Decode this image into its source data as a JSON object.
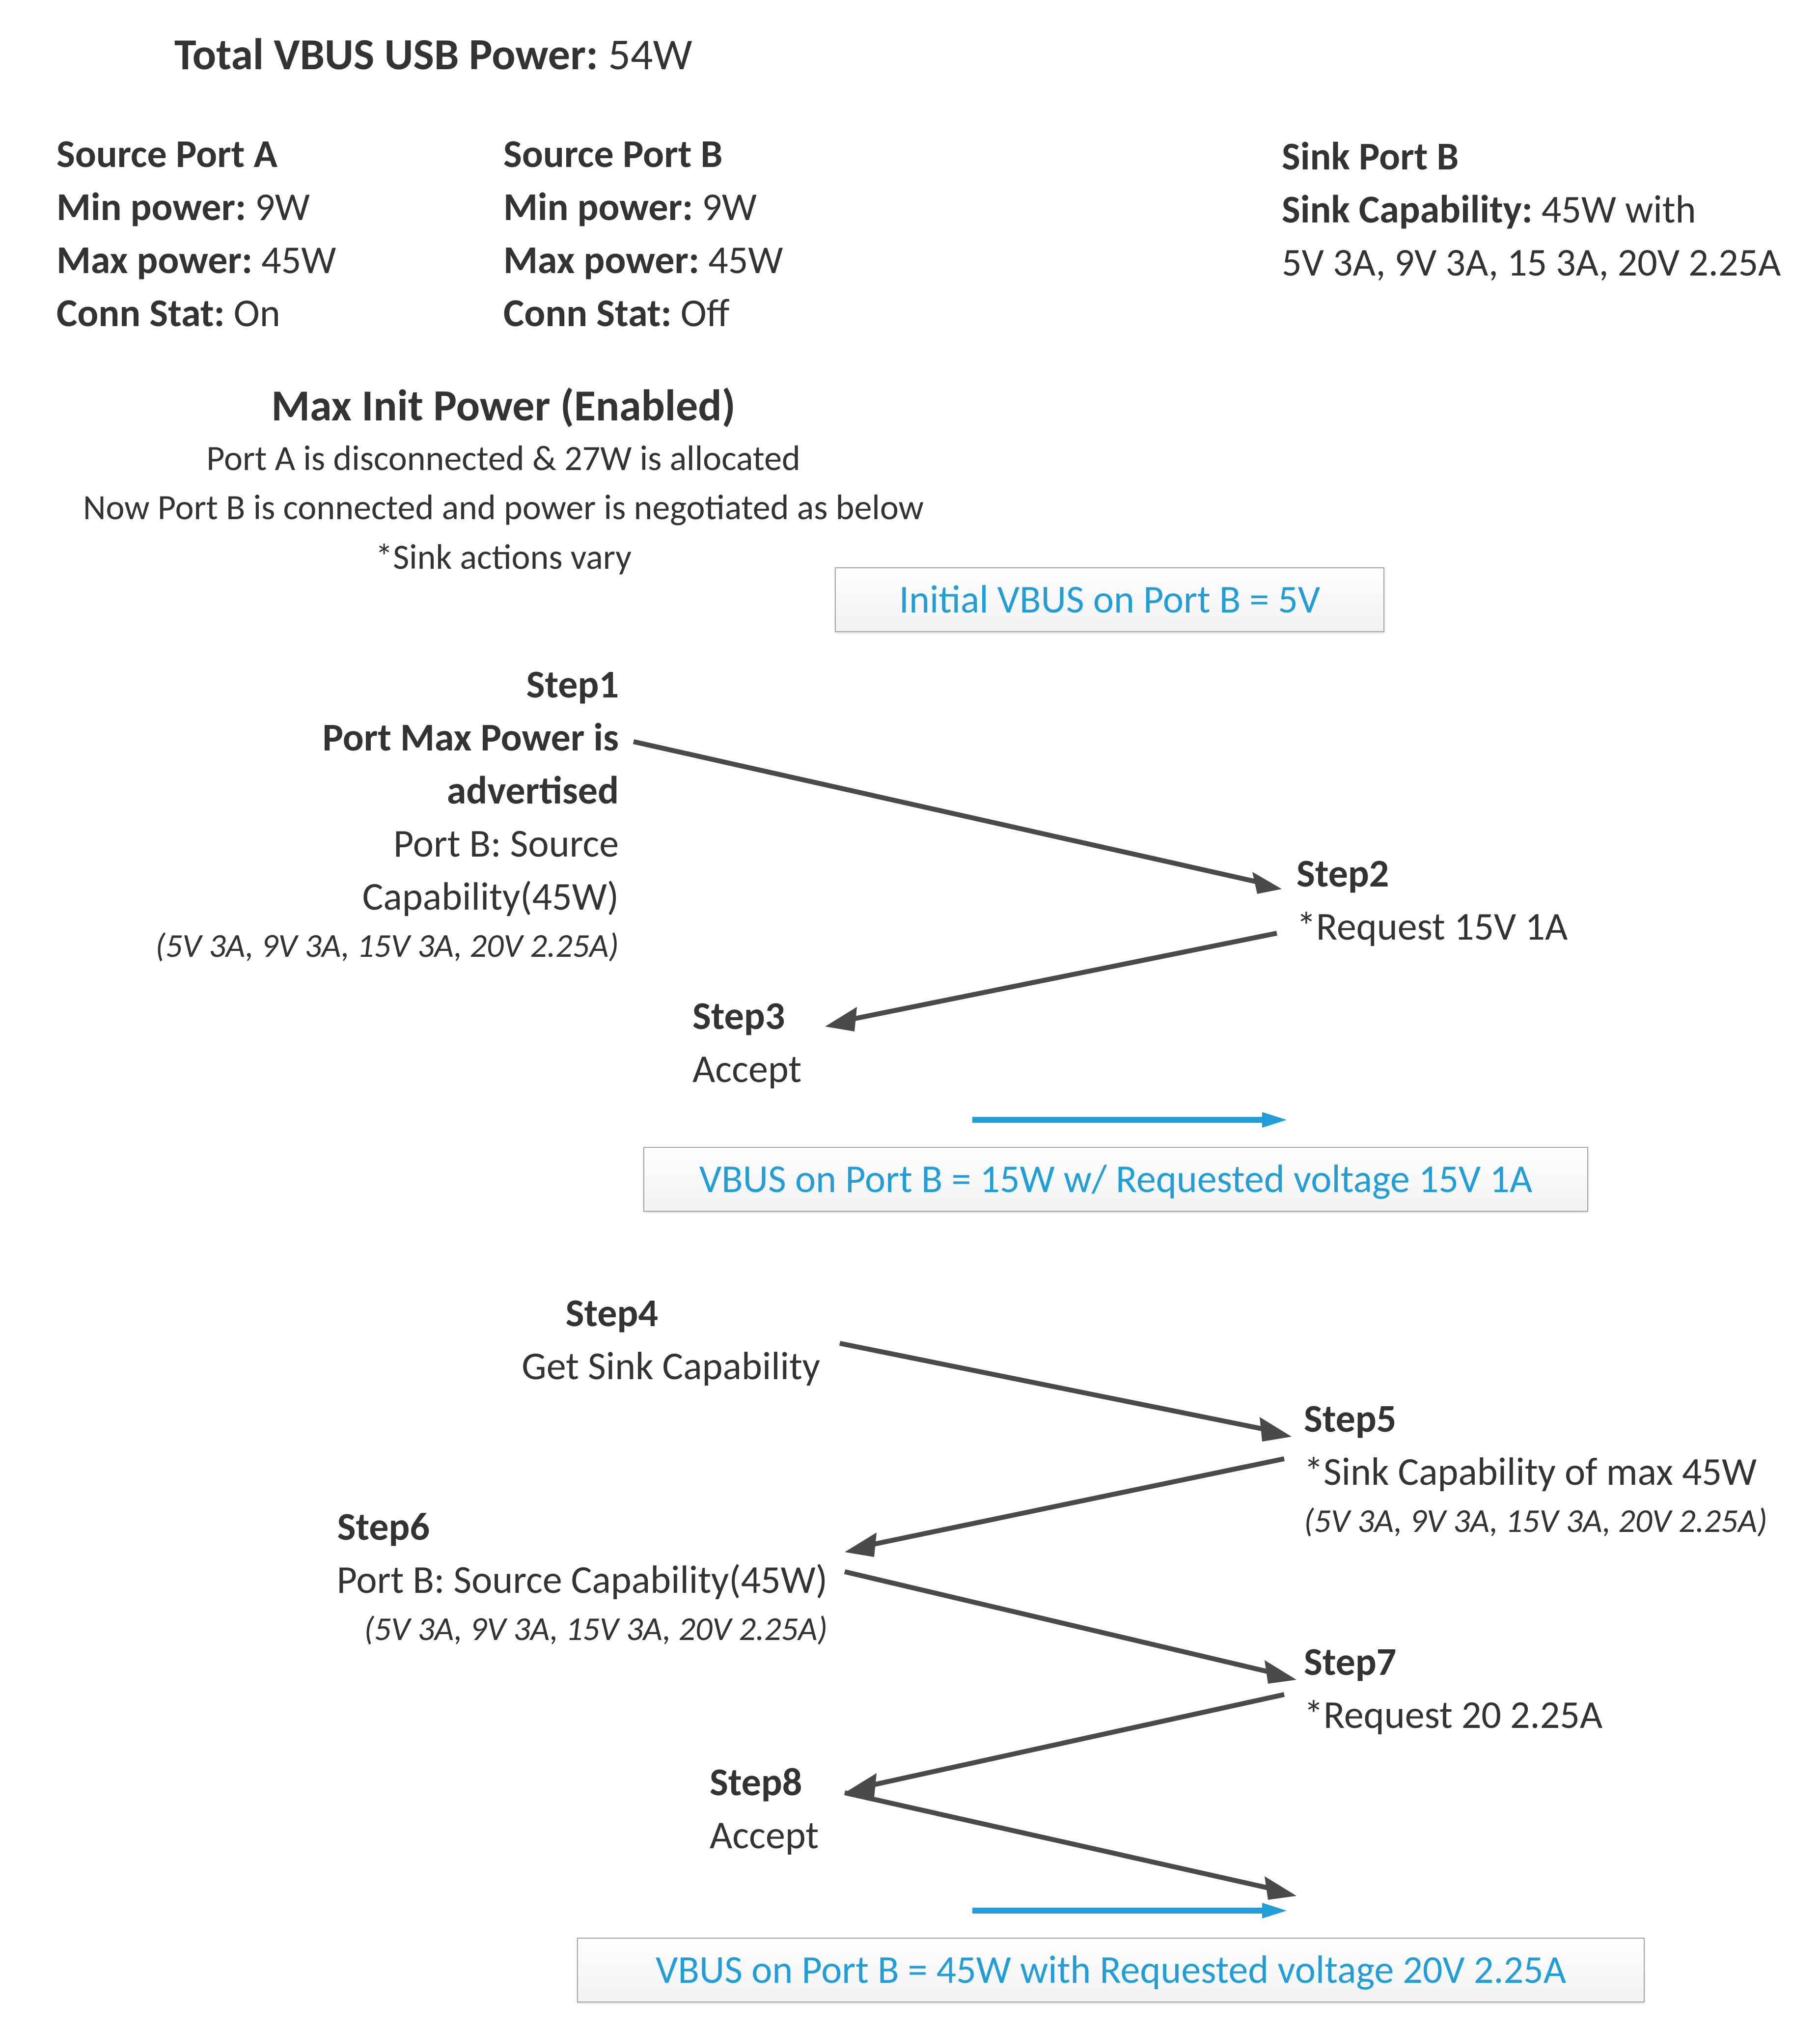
{
  "title_label": "Total VBUS USB Power:",
  "title_value": "54W",
  "source_port_a": {
    "heading": "Source Port A",
    "min_label": "Min power:",
    "min_value": "9W",
    "max_label": "Max power:",
    "max_value": "45W",
    "conn_label": "Conn Stat:",
    "conn_value": "On"
  },
  "source_port_b": {
    "heading": "Source Port B",
    "min_label": "Min power:",
    "min_value": "9W",
    "max_label": "Max power:",
    "max_value": "45W",
    "conn_label": "Conn Stat:",
    "conn_value": "Off"
  },
  "sink_port_b": {
    "heading": "Sink Port B",
    "cap_label": "Sink Capability:",
    "cap_value": "45W with",
    "cap_line2": "5V 3A, 9V 3A, 15 3A, 20V 2.25A"
  },
  "max_init": {
    "heading": "Max Init Power (Enabled)",
    "line1": "Port A is disconnected & 27W is allocated",
    "line2": "Now Port B is connected and power is negotiated as below",
    "line3": "*Sink actions vary"
  },
  "status": {
    "initial": "Initial VBUS on Port B = 5V",
    "vbus_15w": "VBUS on Port B = 15W w/ Requested voltage 15V 1A",
    "vbus_45w": "VBUS on Port B = 45W with Requested voltage 20V 2.25A"
  },
  "steps": {
    "s1": {
      "label": "Step1",
      "line1": "Port Max Power is advertised",
      "line2": "Port B: Source Capability(45W)",
      "line3": "(5V 3A, 9V 3A, 15V 3A, 20V 2.25A)"
    },
    "s2": {
      "label": "Step2",
      "line1": "*Request 15V 1A"
    },
    "s3": {
      "label": "Step3",
      "line1": "Accept"
    },
    "s4": {
      "label": "Step4",
      "line1": "Get Sink Capability"
    },
    "s5": {
      "label": "Step5",
      "line1": "*Sink Capability of max 45W",
      "line2": "(5V 3A, 9V 3A, 15V 3A, 20V 2.25A)"
    },
    "s6": {
      "label": "Step6",
      "line1": "Port B: Source Capability(45W)",
      "line2": "(5V 3A, 9V 3A, 15V 3A, 20V 2.25A)"
    },
    "s7": {
      "label": "Step7",
      "line1": "*Request 20 2.25A"
    },
    "s8": {
      "label": "Step8",
      "line1": "Accept"
    }
  }
}
